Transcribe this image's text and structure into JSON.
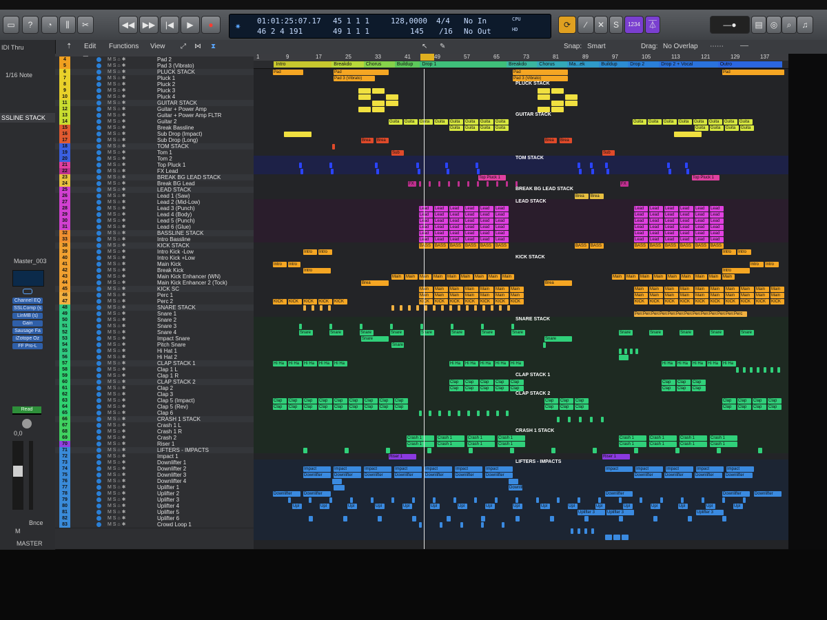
{
  "controlbar": {
    "lcd_time_top": "01:01:25:07.17",
    "lcd_time_bottom": "46 2 4 191",
    "lcd_pos_top": "45 1 1 1",
    "lcd_pos_bottom": "49 1 1 1",
    "lcd_tempo_top": "128,0000",
    "lcd_tempo_bottom": "145",
    "lcd_sig_top": "4/4",
    "lcd_sig_bottom": "/16",
    "lcd_in": "No In",
    "lcd_out": "No Out",
    "lcd_cpu": "CPU",
    "lcd_hd": "HD",
    "badge_1234": "1234",
    "badge_s": "S"
  },
  "toolbar": {
    "edit": "Edit",
    "functions": "Functions",
    "view": "View",
    "snap_label": "Snap:",
    "snap_value": "Smart",
    "drag_label": "Drag:",
    "drag_value": "No Overlap"
  },
  "inspector": {
    "midi_thru": "IDI Thru",
    "note": "1/16 Note",
    "stack": "SSLINE STACK",
    "master": "Master_003",
    "plugins": [
      "Channel EQ",
      "SSLComp (s",
      "LinMB (s)",
      "Gain",
      "Sausage Fa",
      "iZotope Oz",
      "FF Pro-L"
    ],
    "read": "Read",
    "value": "0,0",
    "bnce": "Bnce",
    "m": "M",
    "master_label": "MASTER"
  },
  "ruler": {
    "bars": [
      "1",
      "9",
      "17",
      "25",
      "33",
      "41",
      "49",
      "57",
      "65",
      "73",
      "81",
      "89",
      "97",
      "105",
      "113",
      "121",
      "129",
      "137"
    ]
  },
  "markers": [
    {
      "label": "Intro",
      "color": "#c7c72e",
      "x": 0.038,
      "w": 0.108
    },
    {
      "label": "Breakdo",
      "color": "#b8d83a",
      "x": 0.146,
      "w": 0.06
    },
    {
      "label": "Chorus",
      "color": "#86d24a",
      "x": 0.206,
      "w": 0.058
    },
    {
      "label": "Buildup",
      "color": "#5cc85a",
      "x": 0.264,
      "w": 0.047
    },
    {
      "label": "Drop 1",
      "color": "#3fbf7a",
      "x": 0.311,
      "w": 0.162
    },
    {
      "label": "Breakdo",
      "color": "#3ab6a0",
      "x": 0.473,
      "w": 0.057
    },
    {
      "label": "Chorus",
      "color": "#33a9b8",
      "x": 0.53,
      "w": 0.056
    },
    {
      "label": "Ma...ek",
      "color": "#2f9ac8",
      "x": 0.586,
      "w": 0.06
    },
    {
      "label": "Buildup",
      "color": "#2c8cd2",
      "x": 0.646,
      "w": 0.054
    },
    {
      "label": "Drop 2",
      "color": "#2a7fd8",
      "x": 0.7,
      "w": 0.058
    },
    {
      "label": "Drop 2 + Vocal",
      "color": "#2a72dc",
      "x": 0.758,
      "w": 0.11
    },
    {
      "label": "Outro",
      "color": "#2b66e0",
      "x": 0.868,
      "w": 0.12
    }
  ],
  "tracks": [
    {
      "n": "4",
      "name": "Pad 2",
      "color": "#f0a020"
    },
    {
      "n": "5",
      "name": "Pad 3 (Vibrato)",
      "color": "#f0a020"
    },
    {
      "n": "6",
      "name": "PLUCK STACK",
      "color": "#e8d02a"
    },
    {
      "n": "7",
      "name": "Pluck 1",
      "color": "#e8d02a"
    },
    {
      "n": "8",
      "name": "Pluck 2",
      "color": "#e8d02a"
    },
    {
      "n": "9",
      "name": "Pluck 3",
      "color": "#e8d02a"
    },
    {
      "n": "10",
      "name": "Pluck 4",
      "color": "#e8d02a"
    },
    {
      "n": "11",
      "name": "GUITAR STACK",
      "color": "#c8dc30"
    },
    {
      "n": "12",
      "name": "Guitar + Power Amp",
      "color": "#c8dc30"
    },
    {
      "n": "13",
      "name": "Guitar + Power Amp FLTR",
      "color": "#c8dc30"
    },
    {
      "n": "14",
      "name": "Guitar 2",
      "color": "#c8dc30"
    },
    {
      "n": "15",
      "name": "Break Bassline",
      "color": "#e05a30"
    },
    {
      "n": "16",
      "name": "Sub Drop (Impact)",
      "color": "#e05a30"
    },
    {
      "n": "17",
      "name": "Sub Drop (Long)",
      "color": "#e05a30"
    },
    {
      "n": "18",
      "name": "TOM STACK",
      "color": "#3a5fe0"
    },
    {
      "n": "19",
      "name": "Tom 1",
      "color": "#3a5fe0"
    },
    {
      "n": "20",
      "name": "Tom 2",
      "color": "#3a5fe0"
    },
    {
      "n": "21",
      "name": "Top Pluck 1",
      "color": "#e040a0"
    },
    {
      "n": "22",
      "name": "FX Lead",
      "color": "#c03090"
    },
    {
      "n": "23",
      "name": "BREAK BG LEAD STACK",
      "color": "#e8c040"
    },
    {
      "n": "24",
      "name": "Break BG Lead",
      "color": "#e8c040"
    },
    {
      "n": "25",
      "name": "LEAD STACK",
      "color": "#d040d0"
    },
    {
      "n": "26",
      "name": "Lead 1 (Saw)",
      "color": "#d040d0"
    },
    {
      "n": "27",
      "name": "Lead 2 (Mid-Low)",
      "color": "#d040d0"
    },
    {
      "n": "28",
      "name": "Lead 3 (Punch)",
      "color": "#d040d0"
    },
    {
      "n": "29",
      "name": "Lead 4 (Body)",
      "color": "#d040d0"
    },
    {
      "n": "30",
      "name": "Lead 5 (Punch)",
      "color": "#d040d0"
    },
    {
      "n": "31",
      "name": "Lead 6 (Glue)",
      "color": "#d040d0"
    },
    {
      "n": "32",
      "name": "BASSLINE STACK",
      "color": "#f09030"
    },
    {
      "n": "33",
      "name": "Intro Bassline",
      "color": "#f09030"
    },
    {
      "n": "38",
      "name": "KICK STACK",
      "color": "#f0a030"
    },
    {
      "n": "39",
      "name": "Intro Kick -Low",
      "color": "#f0a030"
    },
    {
      "n": "40",
      "name": "Intro Kick +Low",
      "color": "#f0a030"
    },
    {
      "n": "41",
      "name": "Main Kick",
      "color": "#f0a030"
    },
    {
      "n": "42",
      "name": "Break Kick",
      "color": "#f0a030"
    },
    {
      "n": "43",
      "name": "Main Kick Enhancer (WN)",
      "color": "#f0a030"
    },
    {
      "n": "44",
      "name": "Main Kick Enhancer 2 (Tock)",
      "color": "#f0a030"
    },
    {
      "n": "45",
      "name": "KICK SC",
      "color": "#f0a030"
    },
    {
      "n": "46",
      "name": "Perc 1",
      "color": "#f0b040"
    },
    {
      "n": "47",
      "name": "Perc 2",
      "color": "#f0b040"
    },
    {
      "n": "48",
      "name": "SNARE STACK",
      "color": "#30c880"
    },
    {
      "n": "49",
      "name": "Snare 1",
      "color": "#30c880"
    },
    {
      "n": "50",
      "name": "Snare 2",
      "color": "#30c880"
    },
    {
      "n": "51",
      "name": "Snare 3",
      "color": "#30c880"
    },
    {
      "n": "52",
      "name": "Snare 4",
      "color": "#30c880"
    },
    {
      "n": "53",
      "name": "Impact Snare",
      "color": "#30c880"
    },
    {
      "n": "54",
      "name": "Pitch Snare",
      "color": "#30c880"
    },
    {
      "n": "55",
      "name": "Hi Hat 1",
      "color": "#30c880"
    },
    {
      "n": "56",
      "name": "Hi Hat 2",
      "color": "#30c880"
    },
    {
      "n": "57",
      "name": "CLAP STACK 1",
      "color": "#30d070"
    },
    {
      "n": "58",
      "name": "Clap 1 L",
      "color": "#30d070"
    },
    {
      "n": "59",
      "name": "Clap 1 R",
      "color": "#30d070"
    },
    {
      "n": "60",
      "name": "CLAP STACK 2",
      "color": "#30d070"
    },
    {
      "n": "61",
      "name": "Clap 2",
      "color": "#30d070"
    },
    {
      "n": "62",
      "name": "Clap 3",
      "color": "#30d070"
    },
    {
      "n": "63",
      "name": "Clap 5 (Impact)",
      "color": "#30d070"
    },
    {
      "n": "64",
      "name": "Clap 5 (Rev)",
      "color": "#30d070"
    },
    {
      "n": "65",
      "name": "Clap 6",
      "color": "#30d070"
    },
    {
      "n": "66",
      "name": "CRASH 1 STACK",
      "color": "#40d060"
    },
    {
      "n": "67",
      "name": "Crash 1 L",
      "color": "#40d060"
    },
    {
      "n": "68",
      "name": "Crash 1 R",
      "color": "#40d060"
    },
    {
      "n": "69",
      "name": "Crash 2",
      "color": "#40d060"
    },
    {
      "n": "70",
      "name": "Riser 1",
      "color": "#9040e0"
    },
    {
      "n": "71",
      "name": "LIFTERS - IMPACTS",
      "color": "#3a8ad8"
    },
    {
      "n": "72",
      "name": "Impact 1",
      "color": "#3a8ad8"
    },
    {
      "n": "73",
      "name": "Downlifter 1",
      "color": "#3a8ad8"
    },
    {
      "n": "74",
      "name": "Downlifter 2",
      "color": "#3a8ad8"
    },
    {
      "n": "75",
      "name": "Downlifter 3",
      "color": "#3a8ad8"
    },
    {
      "n": "76",
      "name": "Downlifter 4",
      "color": "#3a8ad8"
    },
    {
      "n": "77",
      "name": "Uplifter 1",
      "color": "#3a8ad8"
    },
    {
      "n": "78",
      "name": "Uplifter 2",
      "color": "#3a8ad8"
    },
    {
      "n": "79",
      "name": "Uplifter 3",
      "color": "#3a8ad8"
    },
    {
      "n": "80",
      "name": "Uplifter 4",
      "color": "#3a8ad8"
    },
    {
      "n": "81",
      "name": "Uplifter 5",
      "color": "#3a8ad8"
    },
    {
      "n": "82",
      "name": "Uplifter 6",
      "color": "#3a8ad8"
    },
    {
      "n": "83",
      "name": "Crowd Loop 1",
      "color": "#3a8ad8"
    }
  ],
  "stack_labels": {
    "pluck": "PLUCK STACK",
    "guitar": "GUITAR STACK",
    "tom": "TOM STACK",
    "breakbg": "BREAK BG LEAD STACK",
    "lead": "LEAD STACK",
    "kick": "KICK STACK",
    "snare": "SNARE STACK",
    "clap1": "CLAP STACK 1",
    "clap2": "CLAP STACK 2",
    "crash": "CRASH 1 STACK",
    "lifters": "LIFTERS - IMPACTS"
  },
  "region_labels": {
    "pad": "Pad",
    "pad3": "Pad 3 (Vibrato)",
    "lead": "Lead",
    "bass": "BASS",
    "main": "Main",
    "kick": "KICK",
    "snare": "Snare",
    "clap": "Clap",
    "crash": "Crash 1",
    "impact": "Impact",
    "down": "Downlifter",
    "up": "Upl",
    "intro": "Intro",
    "sub": "Sub",
    "fx": "FX",
    "perc": "Perc",
    "hihat": "Hi Ha",
    "riser": "Riser 1",
    "break": "Brea",
    "toppluck": "Top Pluck 1",
    "guitar": "Guita",
    "uplifter3": "Uplifter 3"
  }
}
